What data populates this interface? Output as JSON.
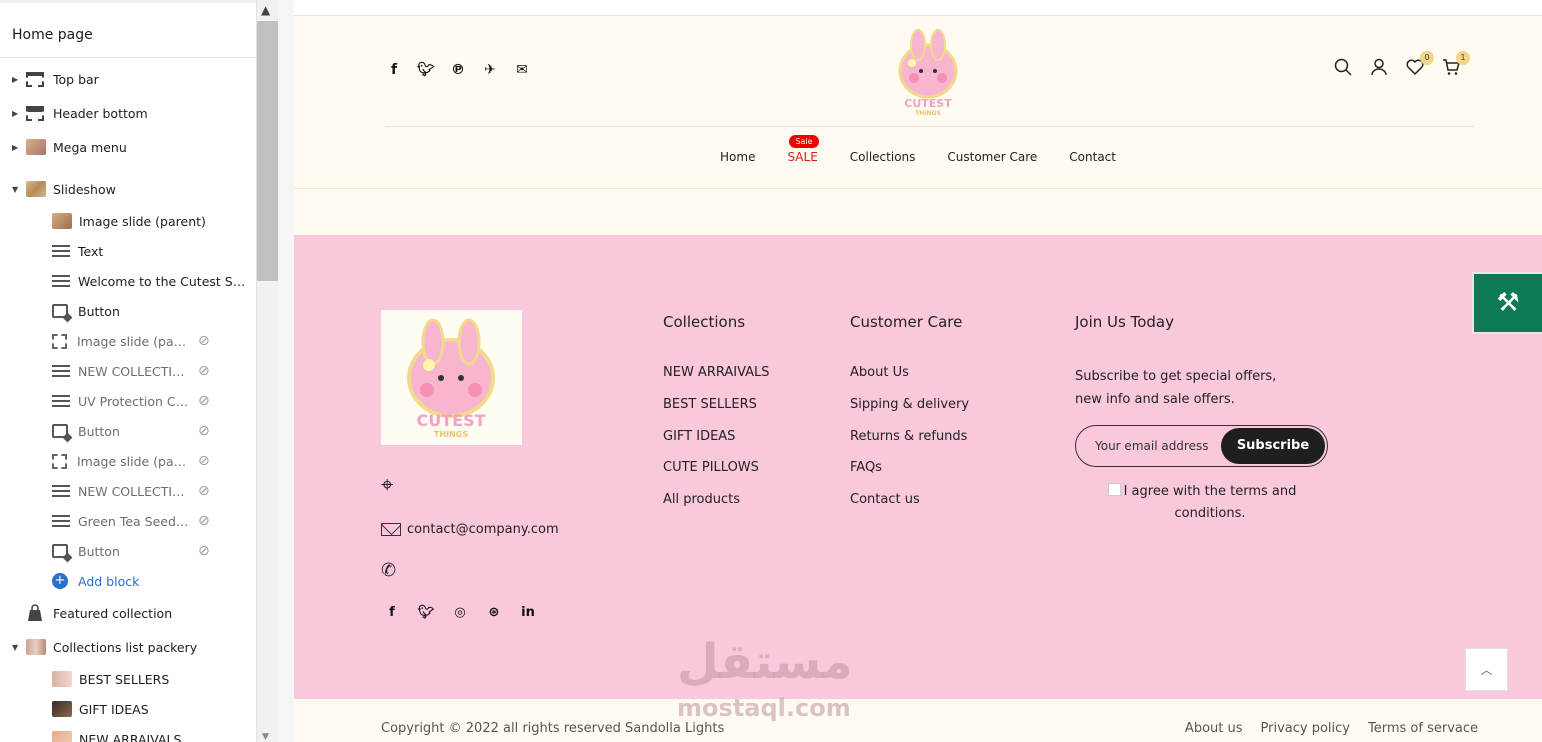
{
  "sidebar": {
    "title": "Home page",
    "sections": [
      {
        "label": "Top bar"
      },
      {
        "label": "Header bottom"
      },
      {
        "label": "Mega menu"
      },
      {
        "label": "Slideshow"
      }
    ],
    "blocks": [
      {
        "label": "Image slide (parent)"
      },
      {
        "label": "Text"
      },
      {
        "label": "Welcome to the Cutest Sho..."
      },
      {
        "label": "Button"
      },
      {
        "label": "Image slide (pare..."
      },
      {
        "label": "NEW COLLECTION"
      },
      {
        "label": "UV Protection Cre..."
      },
      {
        "label": "Button"
      },
      {
        "label": "Image slide (pare..."
      },
      {
        "label": "NEW COLLECTION"
      },
      {
        "label": "Green Tea Seed S..."
      },
      {
        "label": "Button"
      }
    ],
    "add_block": "Add block",
    "featured": "Featured collection",
    "collections_list": "Collections list packery",
    "list_items": [
      {
        "label": "BEST SELLERS"
      },
      {
        "label": "GIFT IDEAS"
      },
      {
        "label": "NEW ARRAIVALS"
      }
    ]
  },
  "header": {
    "logo_text": "CUTEST THINGS",
    "wishlist_count": "0",
    "cart_count": "1",
    "nav": [
      "Home",
      "SALE",
      "Collections",
      "Customer Care",
      "Contact"
    ],
    "sale_badge": "Sale"
  },
  "footer": {
    "logo_text": "CUTEST THINGS",
    "email": "contact@company.com",
    "collections": {
      "title": "Collections",
      "items": [
        "NEW ARRAIVALS",
        "BEST SELLERS",
        "GIFT IDEAS",
        "CUTE PILLOWS",
        "All products"
      ]
    },
    "customer_care": {
      "title": "Customer Care",
      "items": [
        "About Us",
        "Sipping & delivery",
        "Returns & refunds",
        "FAQs",
        "Contact us"
      ]
    },
    "join": {
      "title": "Join Us Today",
      "line1": "Subscribe to get special offers,",
      "line2": "new info and sale offers.",
      "placeholder": "Your email address",
      "subscribe": "Subscribe",
      "agree": "I agree with the terms and conditions."
    },
    "watermark_ar": "مستقل",
    "watermark_en": "mostaql.com"
  },
  "bottom": {
    "copyright": "Copyright © 2022 all rights reserved Sandolla Lights",
    "links": [
      "About us",
      "Privacy policy",
      "Terms of servace"
    ]
  },
  "colors": {
    "header_bg": "#fffbf1",
    "footer_bg": "#f9c8dc",
    "sale_red": "#e01c1c",
    "tool_green": "#0b7a55"
  }
}
